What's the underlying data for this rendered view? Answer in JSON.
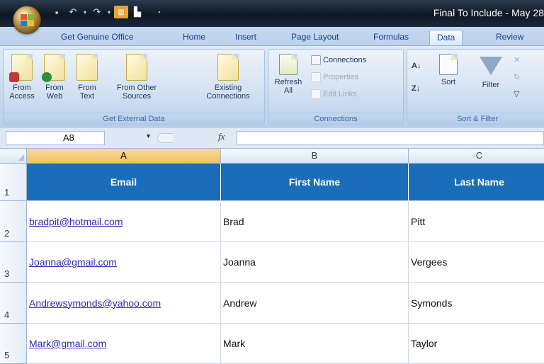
{
  "window": {
    "title": "Final To Include - May 28"
  },
  "tabs": [
    {
      "label": "Get Genuine Office"
    },
    {
      "label": "Home"
    },
    {
      "label": "Insert"
    },
    {
      "label": "Page Layout"
    },
    {
      "label": "Formulas"
    },
    {
      "label": "Data"
    },
    {
      "label": "Review"
    }
  ],
  "ribbon": {
    "external": {
      "group_label": "Get External Data",
      "from_access": "From Access",
      "from_web": "From Web",
      "from_text": "From Text",
      "from_other": "From Other Sources",
      "existing": "Existing Connections"
    },
    "connections": {
      "group_label": "Connections",
      "refresh": "Refresh All",
      "connections": "Connections",
      "properties": "Properties",
      "edit_links": "Edit Links"
    },
    "sortfilter": {
      "group_label": "Sort & Filter",
      "sort": "Sort",
      "filter": "Filter"
    }
  },
  "formula_bar": {
    "name_box": "A8",
    "fx": "fx",
    "formula": ""
  },
  "columns": [
    "A",
    "B",
    "C"
  ],
  "rows": [
    {
      "num": "1",
      "cells": [
        "Email",
        "First Name",
        "Last Name"
      ]
    },
    {
      "num": "2",
      "cells": [
        "bradpit@hotmail.com",
        "Brad",
        "Pitt"
      ]
    },
    {
      "num": "3",
      "cells": [
        "Joanna@gmail.com",
        "Joanna",
        "Vergees"
      ]
    },
    {
      "num": "4",
      "cells": [
        "Andrewsymonds@yahoo.com",
        "Andrew",
        "Symonds"
      ]
    },
    {
      "num": "5",
      "cells": [
        "Mark@gmail.com",
        "Mark",
        "Taylor"
      ]
    }
  ],
  "colors": {
    "header_fill": "#1a6eb9",
    "selected_column": "#f1c15f",
    "link": "#2e2ab3"
  }
}
